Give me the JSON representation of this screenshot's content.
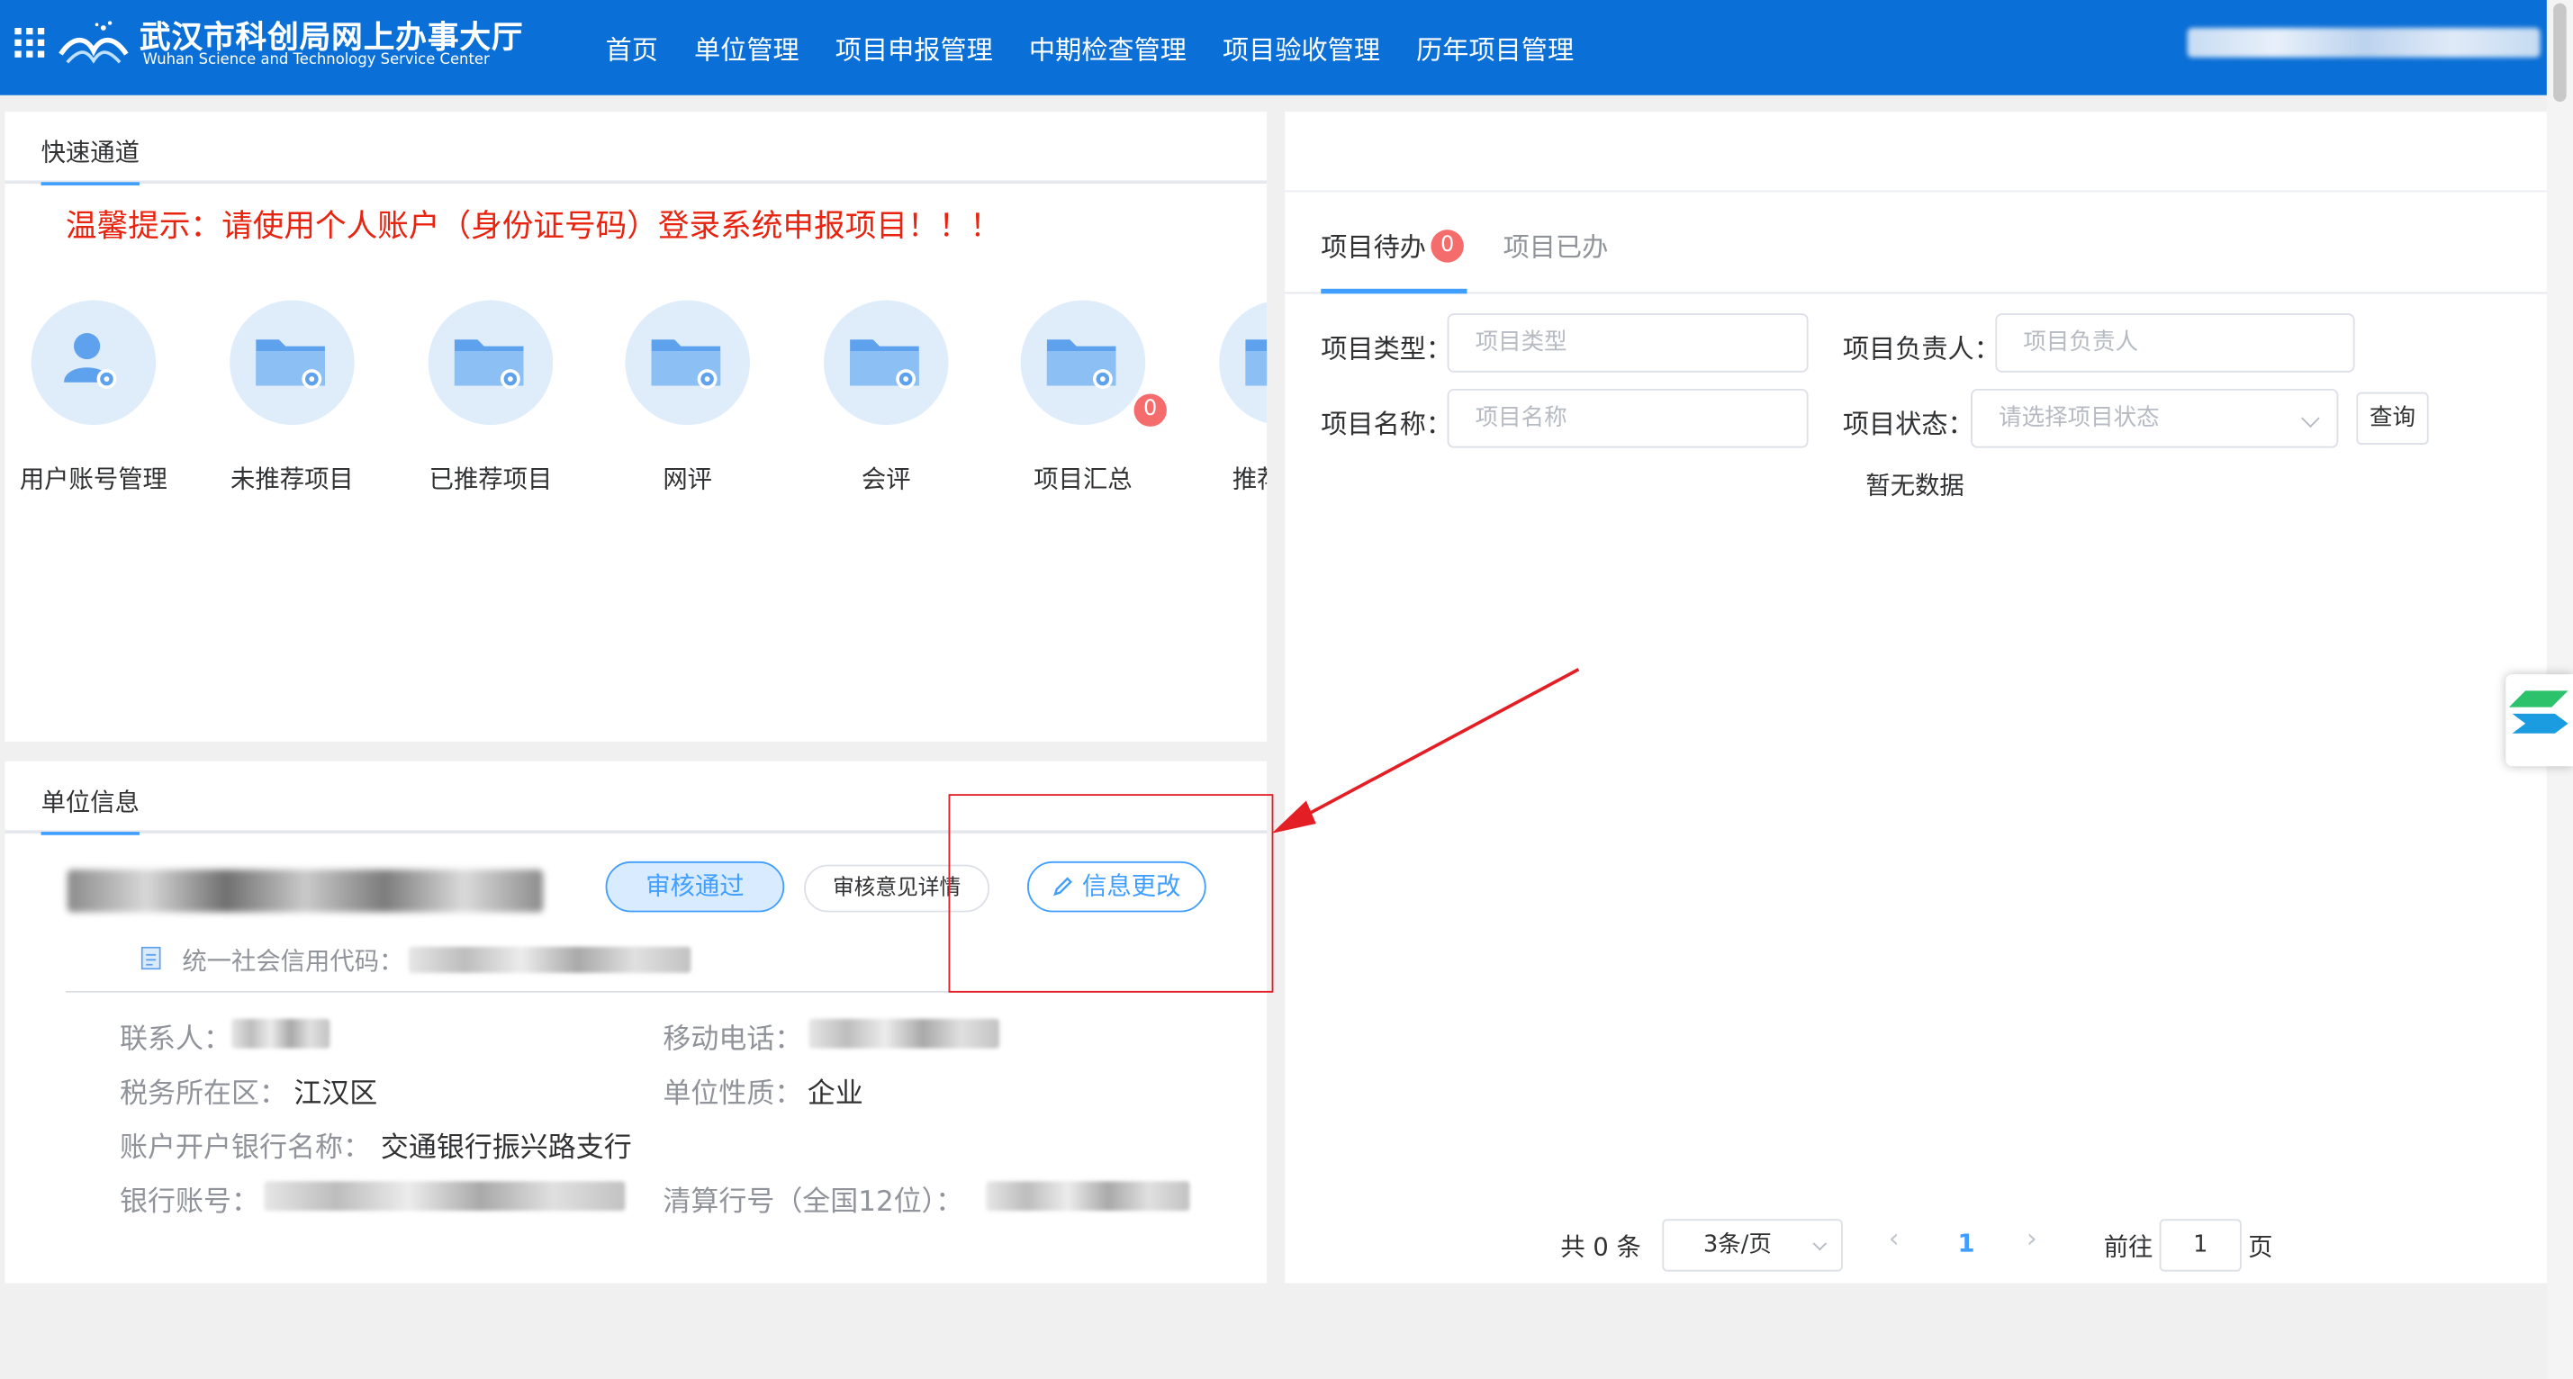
{
  "header": {
    "title": "武汉市科创局网上办事大厅",
    "subtitle": "Wuhan Science and Technology Service Center",
    "nav": [
      "首页",
      "单位管理",
      "项目申报管理",
      "中期检查管理",
      "项目验收管理",
      "历年项目管理"
    ],
    "colors": {
      "bar": "#0a6fd6"
    }
  },
  "quick_panel": {
    "tab": "快速通道",
    "warning": "温馨提示：请使用个人账户（身份证号码）登录系统申报项目！！！",
    "shortcuts": [
      "用户账号管理",
      "未推荐项目",
      "已推荐项目",
      "网评",
      "会评",
      "项目汇总",
      "推荐单位"
    ],
    "badge": "0"
  },
  "unit_panel": {
    "tab": "单位信息",
    "status_button": "审核通过",
    "detail_button": "审核意见详情",
    "edit_button": "信息更改",
    "credit_label": "统一社会信用代码：",
    "fields": {
      "contact_label": "联系人：",
      "mobile_label": "移动电话：",
      "tax_label": "税务所在区：",
      "tax_value": "江汉区",
      "nature_label": "单位性质：",
      "nature_value": "企业",
      "bank_name_label": "账户开户银行名称：",
      "bank_name_value": "交通银行振兴路支行",
      "bank_account_label": "银行账号：",
      "clearing_label": "清算行号（全国12位）："
    }
  },
  "right_panel": {
    "tab_todo": "项目待办",
    "todo_badge": "0",
    "tab_done": "项目已办",
    "filters": {
      "type_label": "项目类型：",
      "type_placeholder": "项目类型",
      "owner_label": "项目负责人：",
      "owner_placeholder": "项目负责人",
      "name_label": "项目名称：",
      "name_placeholder": "项目名称",
      "status_label": "项目状态：",
      "status_placeholder": "请选择项目状态",
      "query_button": "查询"
    },
    "empty_text": "暂无数据",
    "pager": {
      "total": "共 0 条",
      "page_size": "3条/页",
      "current": "1",
      "goto_label": "前往",
      "goto_value": "1",
      "page_unit": "页"
    }
  }
}
